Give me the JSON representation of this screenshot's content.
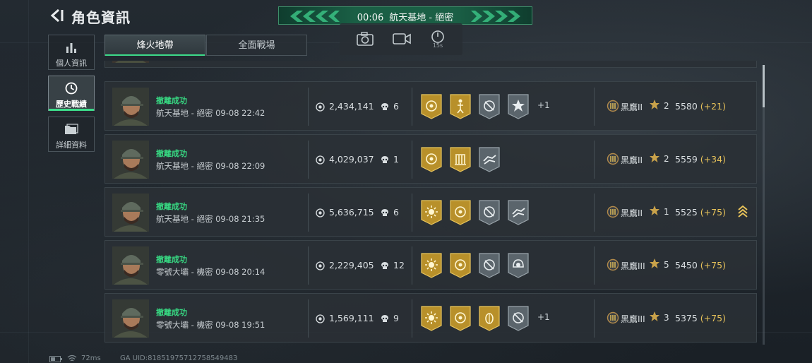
{
  "header": {
    "title": "角色資訊",
    "banner_time": "00:06",
    "banner_map": "航天基地 - 絕密",
    "timer_label": "15s"
  },
  "sidebar": {
    "items": [
      {
        "label": "個人資訊",
        "icon": "bar-chart-icon"
      },
      {
        "label": "歷史戰績",
        "icon": "history-clock-icon",
        "active": true
      },
      {
        "label": "詳細資料",
        "icon": "folder-icon"
      }
    ]
  },
  "tabs": [
    {
      "label": "烽火地帶",
      "active": true
    },
    {
      "label": "全面戰場",
      "active": false
    }
  ],
  "matches": [
    {
      "result": "撤離成功",
      "map_time": "航天基地 - 絕密 09-08 22:42",
      "money": "2,434,141",
      "kills": "6",
      "badges": [
        "gold-emblem",
        "gold-figure",
        "gray-crosshair",
        "gray-star"
      ],
      "more": "+1",
      "rank": "黑鷹II",
      "stars": "2",
      "score": "5580",
      "delta": "+21",
      "promo": false
    },
    {
      "result": "撤離成功",
      "map_time": "航天基地 - 絕密 09-08 22:09",
      "money": "4,029,037",
      "kills": "1",
      "badges": [
        "gold-emblem",
        "gold-pillars",
        "gray-hands"
      ],
      "more": "",
      "rank": "黑鷹II",
      "stars": "2",
      "score": "5559",
      "delta": "+34",
      "promo": false
    },
    {
      "result": "撤離成功",
      "map_time": "航天基地 - 絕密 09-08 21:35",
      "money": "5,636,715",
      "kills": "6",
      "badges": [
        "gold-sun",
        "gold-emblem",
        "gray-crosshair",
        "gray-hands"
      ],
      "more": "",
      "rank": "黑鷹II",
      "stars": "1",
      "score": "5525",
      "delta": "+75",
      "promo": true
    },
    {
      "result": "撤離成功",
      "map_time": "零號大壩 - 機密 09-08 20:14",
      "money": "2,229,405",
      "kills": "12",
      "badges": [
        "gold-sun",
        "gold-emblem",
        "gray-crosshair",
        "gray-helmet"
      ],
      "more": "",
      "rank": "黑鷹III",
      "stars": "5",
      "score": "5450",
      "delta": "+75",
      "promo": false
    },
    {
      "result": "撤離成功",
      "map_time": "零號大壩 - 機密 09-08 19:51",
      "money": "1,569,111",
      "kills": "9",
      "badges": [
        "gold-sun",
        "gold-emblem",
        "gold-bug",
        "gray-crosshair"
      ],
      "more": "+1",
      "rank": "黑鷹III",
      "stars": "3",
      "score": "5375",
      "delta": "+75",
      "promo": false
    }
  ],
  "footer": {
    "ping": "72ms",
    "uid": "GA UID:8185197571275854948З"
  },
  "colors": {
    "accent_green": "#3ddc8a",
    "result_green": "#37d882",
    "delta_gold": "#e8c35a",
    "badge_gold": "#b8902a",
    "badge_gray": "#5b656c"
  }
}
